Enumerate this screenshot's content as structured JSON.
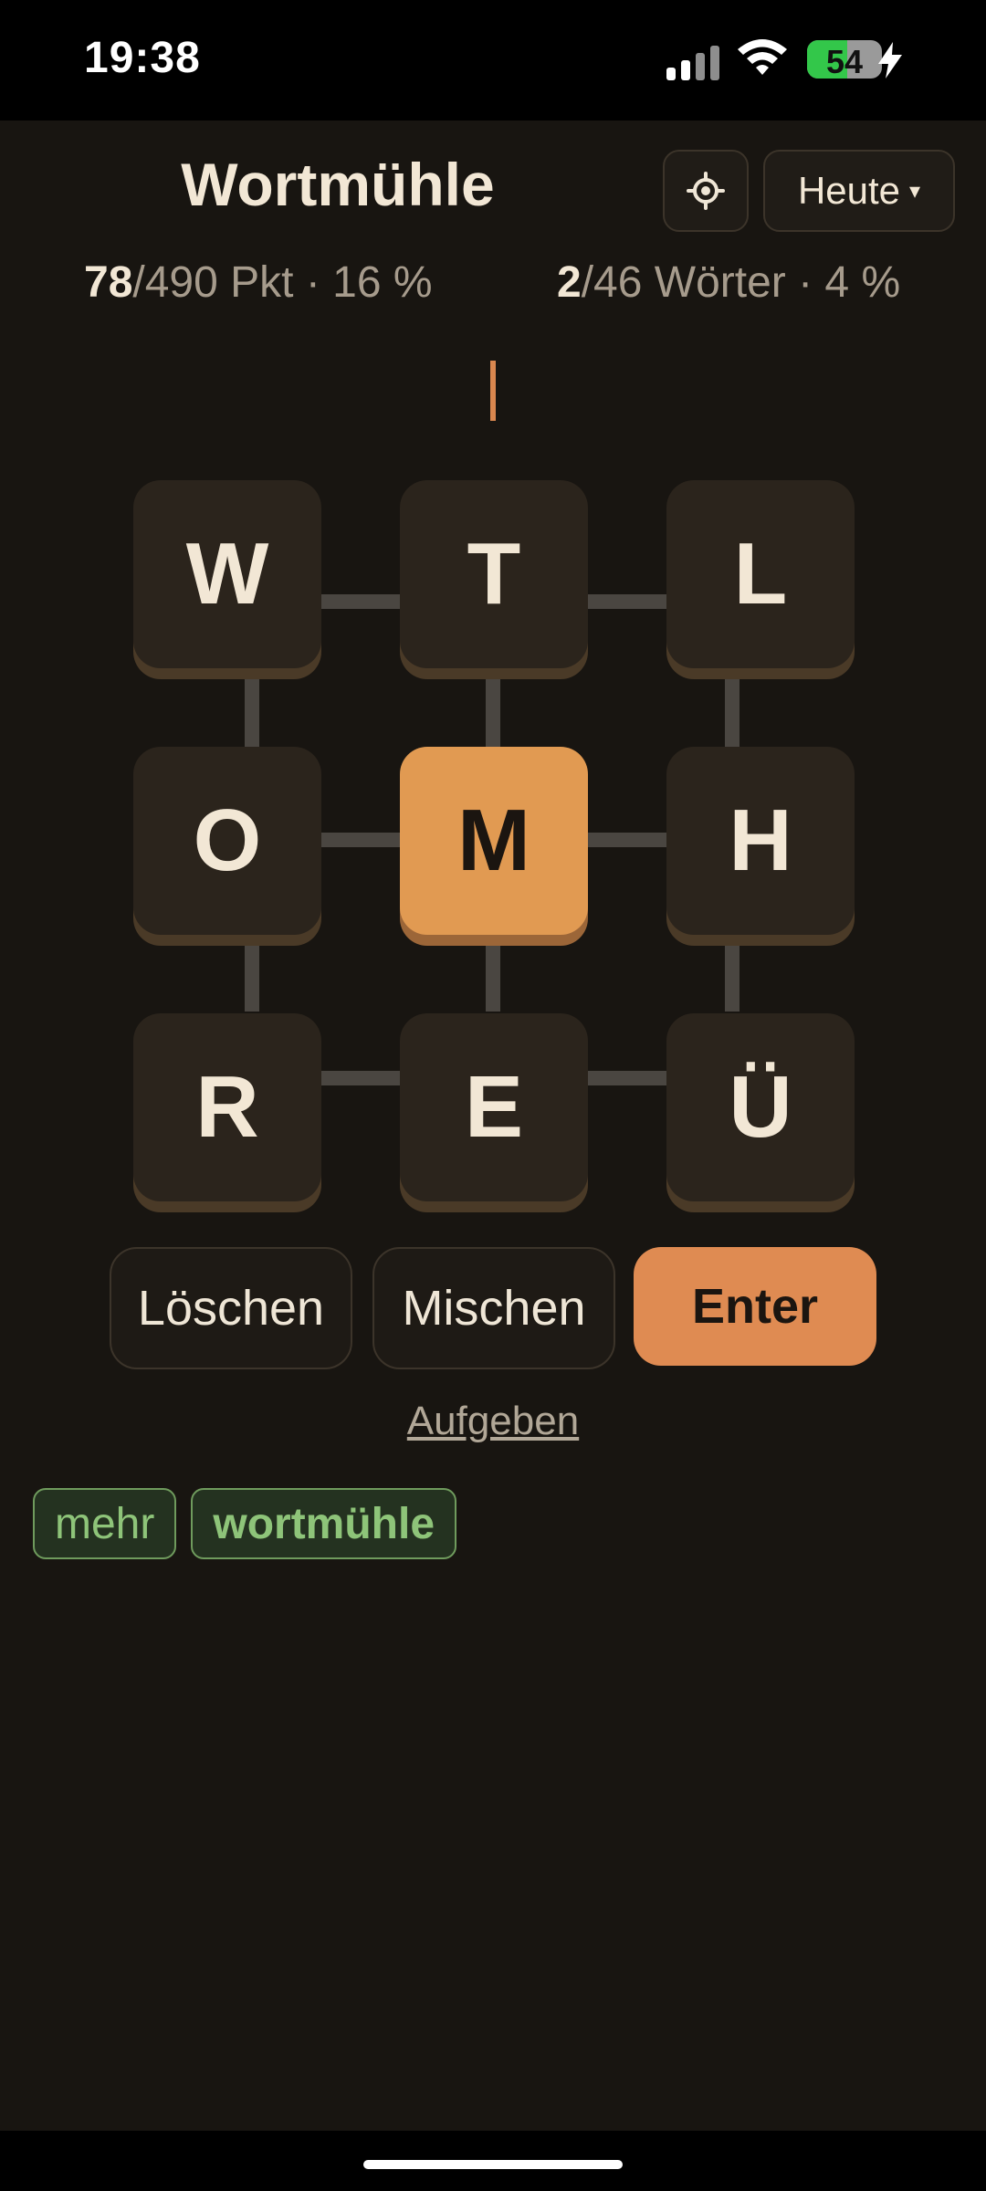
{
  "status": {
    "time": "19:38",
    "battery": "54",
    "battery_level": 0.54
  },
  "header": {
    "title": "Wortmühle",
    "date_label": "Heute",
    "date_caret": "▾",
    "gear_icon": "gear-icon"
  },
  "stats": {
    "points_value": "78",
    "points_rest": "/490 Pkt · 16 %",
    "words_value": "2",
    "words_rest": "/46 Wörter · 4 %"
  },
  "board": {
    "letters": [
      "W",
      "T",
      "L",
      "O",
      "M",
      "H",
      "R",
      "E",
      "Ü"
    ],
    "center_color": "#e19a52"
  },
  "buttons": {
    "delete": "Löschen",
    "shuffle": "Mischen",
    "enter": "Enter",
    "give_up": "Aufgeben"
  },
  "found_words": [
    "mehr",
    "wortmühle"
  ]
}
